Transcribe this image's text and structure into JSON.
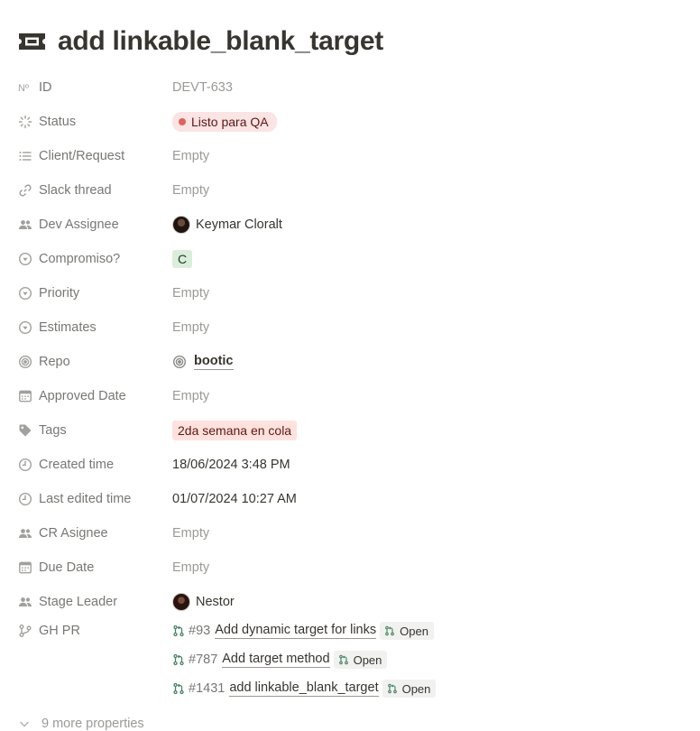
{
  "page": {
    "title": "add linkable_blank_target",
    "icon": "ticket-icon"
  },
  "properties": [
    {
      "key": "id",
      "label": "ID",
      "icon": "number-icon",
      "value": "DEVT-633",
      "kind": "muted"
    },
    {
      "key": "status",
      "label": "Status",
      "icon": "status-icon",
      "value": "Listo para QA",
      "kind": "status",
      "color": "#e16259"
    },
    {
      "key": "client_request",
      "label": "Client/Request",
      "icon": "list-icon",
      "value": "Empty",
      "kind": "empty"
    },
    {
      "key": "slack_thread",
      "label": "Slack thread",
      "icon": "link-icon",
      "value": "Empty",
      "kind": "empty"
    },
    {
      "key": "dev_assignee",
      "label": "Dev Assignee",
      "icon": "people-icon",
      "value": "Keymar Cloralt",
      "kind": "person"
    },
    {
      "key": "compromiso",
      "label": "Compromiso?",
      "icon": "select-icon",
      "value": "C",
      "kind": "tag-green"
    },
    {
      "key": "priority",
      "label": "Priority",
      "icon": "select-icon",
      "value": "Empty",
      "kind": "empty"
    },
    {
      "key": "estimates",
      "label": "Estimates",
      "icon": "select-icon",
      "value": "Empty",
      "kind": "empty"
    },
    {
      "key": "repo",
      "label": "Repo",
      "icon": "relation-icon",
      "value": "bootic",
      "kind": "relation"
    },
    {
      "key": "approved_date",
      "label": "Approved Date",
      "icon": "calendar-icon",
      "value": "Empty",
      "kind": "empty"
    },
    {
      "key": "tags",
      "label": "Tags",
      "icon": "tag-icon",
      "value": "2da semana en cola",
      "kind": "tag-red"
    },
    {
      "key": "created_time",
      "label": "Created time",
      "icon": "clock-icon",
      "value": "18/06/2024 3:48 PM",
      "kind": "text"
    },
    {
      "key": "last_edited_time",
      "label": "Last edited time",
      "icon": "clock-icon",
      "value": "01/07/2024 10:27 AM",
      "kind": "text"
    },
    {
      "key": "cr_asignee",
      "label": "CR Asignee",
      "icon": "people-icon",
      "value": "Empty",
      "kind": "empty"
    },
    {
      "key": "due_date",
      "label": "Due Date",
      "icon": "calendar-icon",
      "value": "Empty",
      "kind": "empty"
    },
    {
      "key": "stage_leader",
      "label": "Stage Leader",
      "icon": "people-icon",
      "value": "Nestor",
      "kind": "person"
    }
  ],
  "gh_pr": {
    "label": "GH PR",
    "icon": "git-branch-icon",
    "items": [
      {
        "number": "#93",
        "title": "Add dynamic target for links",
        "state": "Open"
      },
      {
        "number": "#787",
        "title": "Add target method",
        "state": "Open"
      },
      {
        "number": "#1431",
        "title": "add linkable_blank_target",
        "state": "Open"
      }
    ]
  },
  "more_properties": "9 more properties"
}
